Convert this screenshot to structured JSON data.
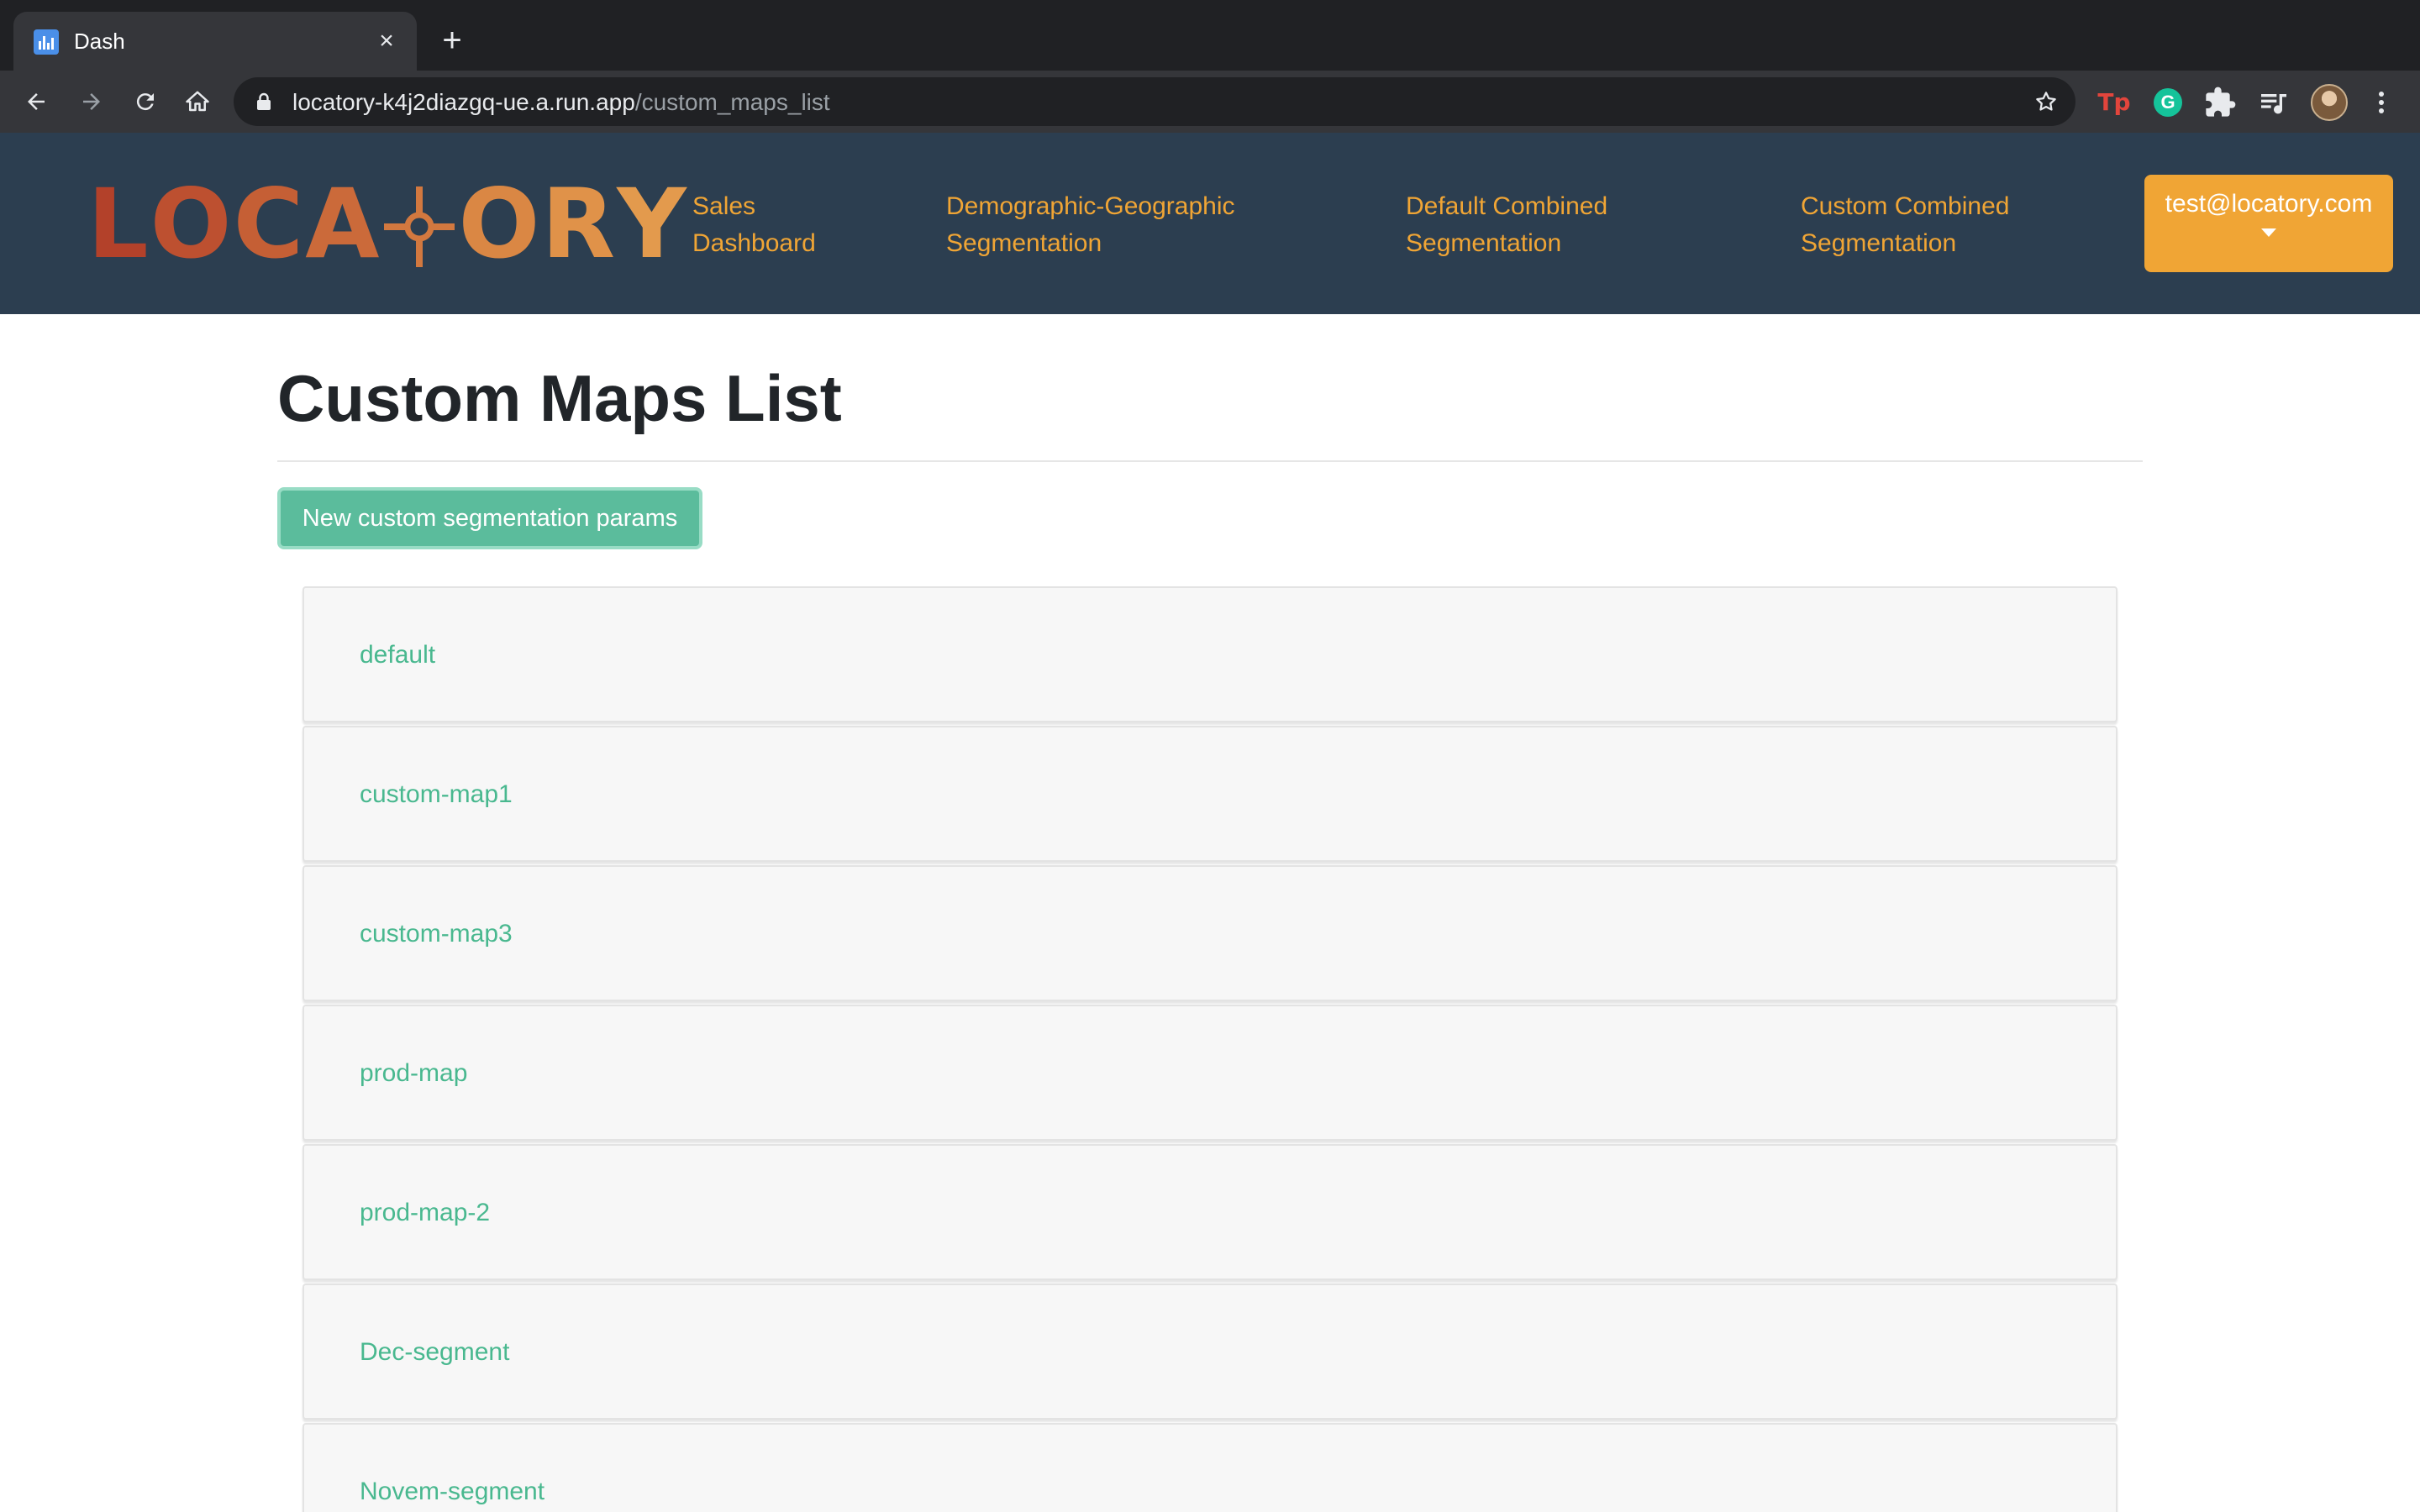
{
  "browser": {
    "tab_title": "Dash",
    "tab_close": "×",
    "new_tab": "+",
    "url_host": "locatory-k4j2diazgq-ue.a.run.app",
    "url_path": "/custom_maps_list",
    "extensions": [
      {
        "name": "tp-extension",
        "label": "Tp"
      },
      {
        "name": "grammarly-extension",
        "label": "G"
      }
    ]
  },
  "navbar": {
    "logo": {
      "text": "LOCATORY",
      "letters": [
        "L",
        "O",
        "C",
        "A",
        "T",
        "O",
        "R",
        "Y"
      ],
      "colors": [
        "#b3412a",
        "#bd5030",
        "#c55f35",
        "#cb6a3a",
        "#d2783f",
        "#da8744",
        "#e09249",
        "#e39a4d"
      ]
    },
    "links": [
      {
        "label": "Sales\nDashboard"
      },
      {
        "label": "Demographic-Geographic\nSegmentation"
      },
      {
        "label": "Default Combined\nSegmentation"
      },
      {
        "label": "Custom Combined\nSegmentation"
      }
    ],
    "user_email": "test@locatory.com"
  },
  "main": {
    "title": "Custom Maps List",
    "new_button_label": "New custom segmentation params",
    "maps": [
      {
        "name": "default"
      },
      {
        "name": "custom-map1"
      },
      {
        "name": "custom-map3"
      },
      {
        "name": "prod-map"
      },
      {
        "name": "prod-map-2"
      },
      {
        "name": "Dec-segment"
      },
      {
        "name": "Novem-segment"
      }
    ]
  },
  "colors": {
    "navbar_bg": "#2c3e50",
    "accent_orange": "#f0a535",
    "accent_green": "#5bbc9c",
    "link_green": "#49b88f"
  }
}
